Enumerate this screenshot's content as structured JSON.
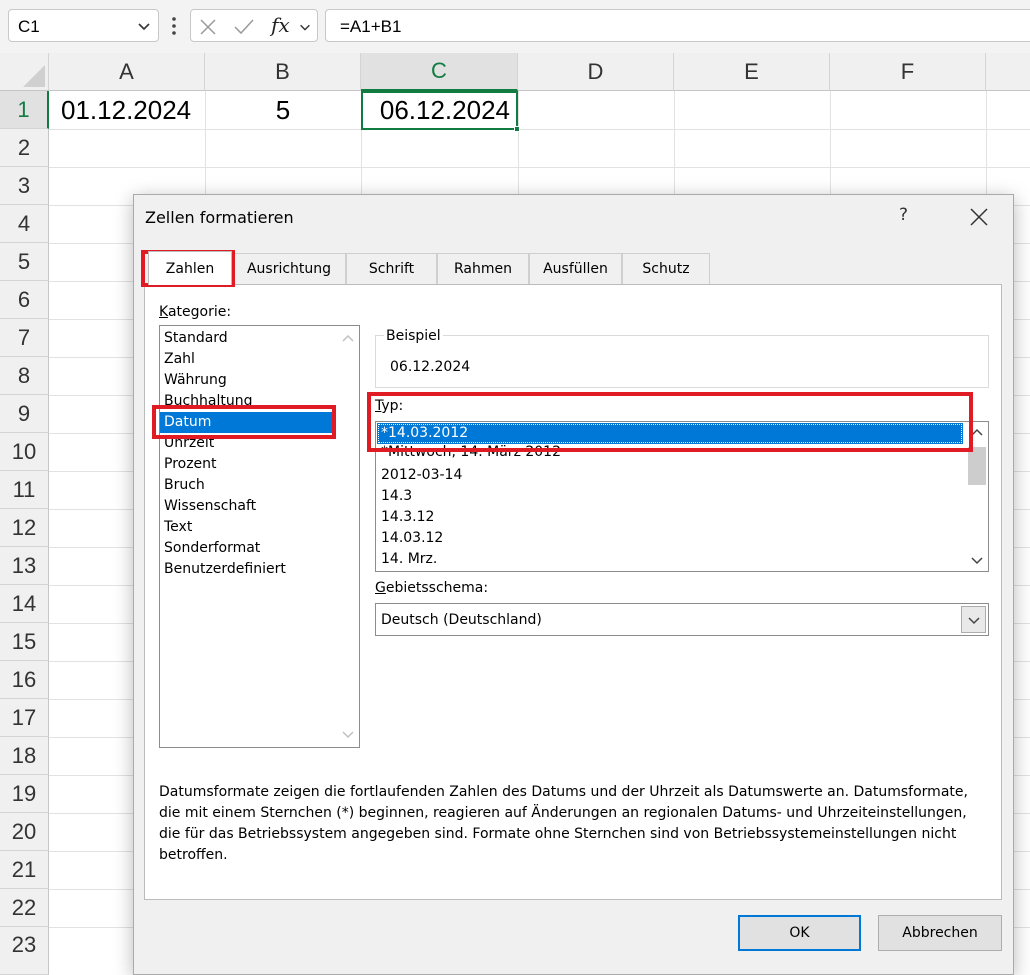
{
  "formula_bar": {
    "name_box": "C1",
    "formula": "=A1+B1",
    "fx_label": "fx"
  },
  "grid": {
    "columns": [
      "A",
      "B",
      "C",
      "D",
      "E",
      "F"
    ],
    "rows": [
      "1",
      "2",
      "3",
      "4",
      "5",
      "6",
      "7",
      "8",
      "9",
      "10",
      "11",
      "12",
      "13",
      "14",
      "15",
      "16",
      "17",
      "18",
      "19",
      "20",
      "21",
      "22",
      "23"
    ],
    "selected_cell": "C1",
    "cells": {
      "A1": "01.12.2024",
      "B1": "5",
      "C1": "06.12.2024"
    }
  },
  "dialog": {
    "title": "Zellen formatieren",
    "help": "?",
    "tabs": [
      "Zahlen",
      "Ausrichtung",
      "Schrift",
      "Rahmen",
      "Ausfüllen",
      "Schutz"
    ],
    "active_tab": "Zahlen",
    "kategorie_label_u": "K",
    "kategorie_label_rest": "ategorie:",
    "categories": [
      "Standard",
      "Zahl",
      "Währung",
      "Buchhaltung",
      "Datum",
      "Uhrzeit",
      "Prozent",
      "Bruch",
      "Wissenschaft",
      "Text",
      "Sonderformat",
      "Benutzerdefiniert"
    ],
    "selected_category": "Datum",
    "beispiel_label": "Beispiel",
    "beispiel_value": "06.12.2024",
    "typ_label_u": "T",
    "typ_label_rest": "yp:",
    "types": [
      "*14.03.2012",
      "*Mittwoch, 14. März 2012",
      "2012-03-14",
      "14.3",
      "14.3.12",
      "14.03.12",
      "14. Mrz."
    ],
    "selected_type": "*14.03.2012",
    "gebiet_label_u": "G",
    "gebiet_label_rest": "ebietsschema:",
    "gebiet_value": "Deutsch (Deutschland)",
    "description": "Datumsformate zeigen die fortlaufenden Zahlen des Datums und der Uhrzeit als Datumswerte an. Datumsformate, die mit einem Sternchen (*) beginnen, reagieren auf Änderungen an regionalen Datums- und Uhrzeiteinstellungen, die für das Betriebssystem angegeben sind. Formate ohne Sternchen sind von Betriebssystemeinstellungen nicht betroffen.",
    "ok_label": "OK",
    "cancel_label": "Abbrechen"
  },
  "colors": {
    "excel_green": "#107c41",
    "selection_blue": "#0078d7",
    "highlight_red": "#e01b24"
  }
}
